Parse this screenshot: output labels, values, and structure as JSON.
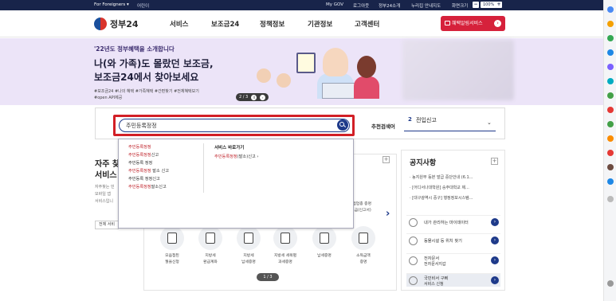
{
  "topbar": {
    "lang_label": "For Foreigners ▾",
    "lang2_label": "어린이",
    "links": [
      "My GOV",
      "로그아웃",
      "정부24소개",
      "누리집 안내지도",
      "화면크기"
    ],
    "zoom_minus": "−",
    "zoom_value": "100%",
    "zoom_plus": "+"
  },
  "header": {
    "logo_text": "정부24",
    "nav": [
      "서비스",
      "보조금24",
      "정책정보",
      "기관정보",
      "고객센터"
    ],
    "apply_button": "혜택알림서비스"
  },
  "hero": {
    "subtitle": "'22년도 정부혜택을 소개합니다",
    "title_line1": "나(와 가족)도 몰랐던 보조금,",
    "title_line2": "보조금24에서 찾아보세요",
    "tags_line1": "#보조금24 #나의 혜택 #가족혜택 #간편찾기 #전체혜택보기",
    "tags_line2": "#open API제공",
    "pager_text": "2 / 3"
  },
  "search": {
    "value": "주민등록정정",
    "rec_label": "추천검색어",
    "rec_num": "2",
    "rec_value": "전입신고",
    "chevron": "⌄"
  },
  "dropdown": {
    "suggestions": [
      {
        "hl": "주민등록정정",
        "rest": ""
      },
      {
        "hl": "주민등록정정",
        "rest": "신고"
      },
      {
        "hl": "",
        "rest": "주민등록 정정"
      },
      {
        "hl": "주민등록정정",
        "rest": " 발소 신고"
      },
      {
        "hl": "",
        "rest": "주민등록 정정신고"
      },
      {
        "hl": "주민등록정정",
        "rest": "말소신고"
      }
    ],
    "service_title": "서비스 바로가기",
    "service_hl": "주민등록정정",
    "service_rest": "(발소)신고 ›"
  },
  "favorites": {
    "title1": "자주 찾",
    "title2": "서비스",
    "desc": [
      "자주찾는 민",
      "모바일 앱",
      "서비스입니"
    ],
    "all_button": "전체 서비",
    "plus": "+"
  },
  "services": [
    {
      "label1": "모음접된",
      "label2": "월을신청"
    },
    {
      "label1": "지방세",
      "label2": "환급계좌"
    },
    {
      "label1": "지방세",
      "label2": "납세증명"
    },
    {
      "label1": "지방세 세목별",
      "label2": "과세증명"
    },
    {
      "label1": "납세증명",
      "label2": ""
    },
    {
      "label1": "소득금액",
      "label2": "증명"
    }
  ],
  "services_top_label": [
    "체험업종 증명",
    "(모금/신고서)"
  ],
  "services_next": "›",
  "services_pager": "1 / 3",
  "notice": {
    "title": "공지사항",
    "plus": "+",
    "items": [
      "· 농지원부 등본 발급 중단안내 (6.1...",
      "· [어디서나대학원] 숭주대학교 제...",
      "· [대구광역시 중구] 행정정보시스템..."
    ]
  },
  "quick_links": [
    {
      "line1": "내가 관리하는 마이데이터",
      "line2": ""
    },
    {
      "line1": "동물시설 등 위치 찾기",
      "line2": ""
    },
    {
      "line1": "전자문서",
      "line2": "전자문서지갑"
    },
    {
      "line1": "국민비서 구삐",
      "line2": "서비스 신청"
    }
  ],
  "quick_go": "›",
  "colors": {
    "navy": "#18244a",
    "brand_blue": "#1e3a8a",
    "accent_red": "#d21f26",
    "hero_bg": "#ece4f8"
  }
}
